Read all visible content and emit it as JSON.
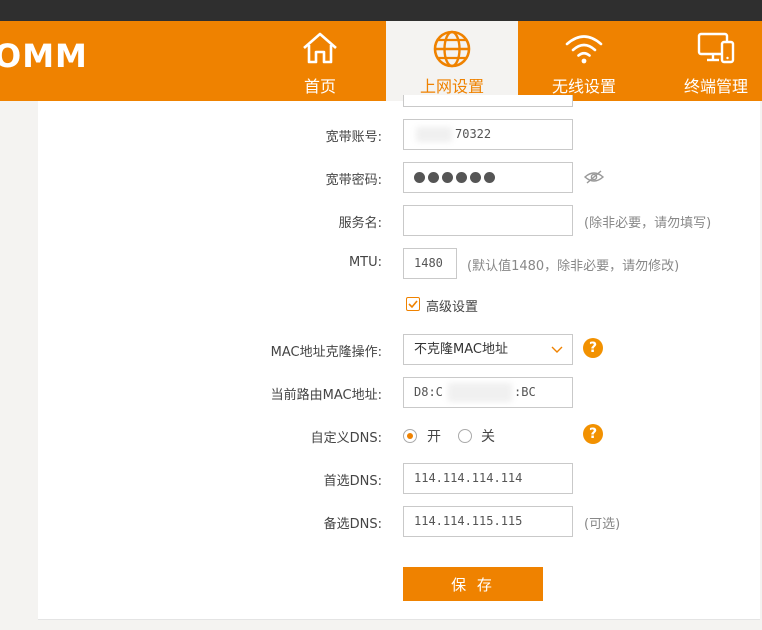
{
  "header": {
    "logo": "OMM",
    "nav": [
      {
        "label": "首页",
        "icon": "home-icon"
      },
      {
        "label": "上网设置",
        "icon": "globe-icon",
        "active": true
      },
      {
        "label": "无线设置",
        "icon": "wifi-icon"
      },
      {
        "label": "终端管理",
        "icon": "devices-icon"
      }
    ]
  },
  "form": {
    "account_label": "宽带账号:",
    "account_value": "70322",
    "password_label": "宽带密码:",
    "password_dots": 6,
    "service_label": "服务名:",
    "service_value": "",
    "service_hint": "(除非必要，请勿填写)",
    "mtu_label": "MTU:",
    "mtu_value": "1480",
    "mtu_hint": "(默认值1480，除非必要，请勿修改)",
    "advanced_label": "高级设置",
    "advanced_checked": true,
    "mac_clone_label": "MAC地址克隆操作:",
    "mac_clone_value": "不克隆MAC地址",
    "current_mac_label": "当前路由MAC地址:",
    "current_mac_prefix": "D8:C",
    "current_mac_suffix": ":BC",
    "custom_dns_label": "自定义DNS:",
    "dns_on_label": "开",
    "dns_off_label": "关",
    "dns_on_selected": true,
    "primary_dns_label": "首选DNS:",
    "primary_dns_value": "114.114.114.114",
    "secondary_dns_label": "备选DNS:",
    "secondary_dns_value": "114.114.115.115",
    "secondary_dns_hint": "(可选)",
    "save_label": "保 存"
  },
  "colors": {
    "accent": "#ef8200",
    "help": "#f29100"
  }
}
